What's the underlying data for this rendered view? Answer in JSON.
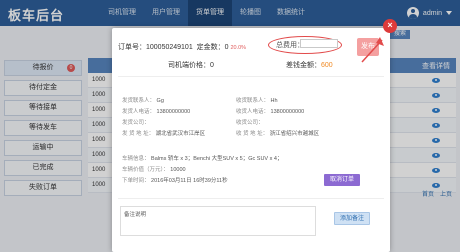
{
  "app": {
    "brand": "板车后台",
    "user": "admin"
  },
  "nav": [
    "司机管理",
    "用户管理",
    "货单管理",
    "轮播图",
    "数据统计"
  ],
  "sidebar": [
    {
      "label": "待报价",
      "badge": "0"
    },
    {
      "label": "待付定金"
    },
    {
      "label": "等待接单"
    },
    {
      "label": "等待发车"
    },
    {
      "label": "运输中"
    },
    {
      "label": "已完成"
    },
    {
      "label": "失败订单"
    }
  ],
  "table": {
    "header_right": "查看详情",
    "search_label": "搜索",
    "row_prefixes": [
      "1000",
      "1000",
      "1000",
      "1000",
      "1000",
      "1000",
      "1000",
      "1000"
    ],
    "pager": [
      "首页",
      "上页"
    ]
  },
  "modal": {
    "order_label": "订单号：",
    "order_no": "100050249101",
    "deposit_label": "定金数：",
    "deposit_value": "0",
    "deposit_extra": "20.0%",
    "total_label": "总费用：",
    "publish_label": "发布",
    "driver_price_label": "司机端价格：",
    "driver_price_value": "0",
    "diff_label": "差钱金额：",
    "diff_value": "600",
    "sender_name_label": "发货联系人：",
    "sender_name": "Gg",
    "sender_phone_label": "发货人电话：",
    "sender_phone": "13800000000",
    "sender_company_label": "发货公司：",
    "sender_company": "",
    "sender_addr_label": "发 货 地 址：",
    "sender_addr": "湖北省武汉市江岸区",
    "receiver_name_label": "收货联系人：",
    "receiver_name": "Hh",
    "receiver_phone_label": "收货人电话：",
    "receiver_phone": "13800000000",
    "receiver_company_label": "收货公司：",
    "receiver_company": "",
    "receiver_addr_label": "收 货 地 址：",
    "receiver_addr": "浙江省绍兴市越城区",
    "car_type_label": "车辆信息：",
    "car_type": "Balms 轿车 x 3；Benchi 大型SUV x 5；Gc SUV x 4；",
    "car_value_label": "车辆价值（万元）：",
    "car_value": "10000",
    "order_time_label": "下单时间：",
    "order_time": "2016年03月11日 16时39分11秒",
    "cancel_label": "取消订单",
    "note_label": "备注说明",
    "add_note_label": "添加备注",
    "close_label": "×"
  },
  "colors": {
    "topbar": "#2e5f9a",
    "accent": "#e05b5b",
    "purple": "#8c6ad2"
  }
}
